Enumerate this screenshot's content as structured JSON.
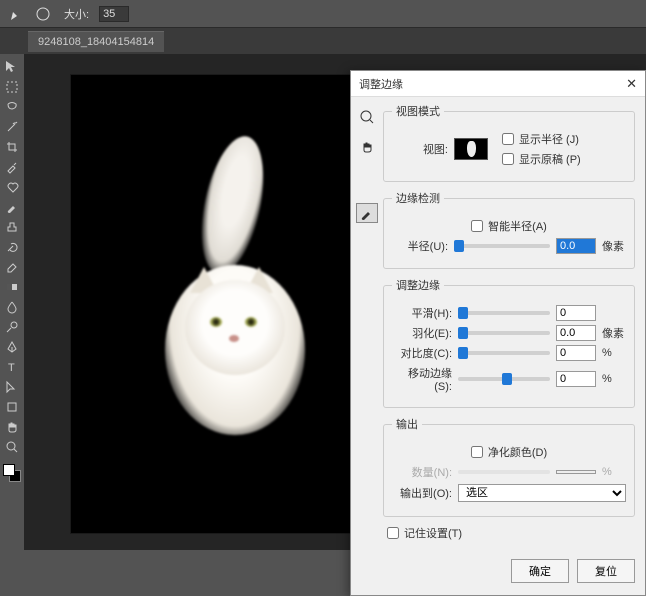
{
  "topbar": {
    "size_label": "大小:",
    "size_value": "35"
  },
  "tab": {
    "name": "9248108_18404154814"
  },
  "dialog": {
    "title": "调整边缘",
    "view": {
      "legend": "视图模式",
      "view_label": "视图:",
      "show_radius": "显示半径 (J)",
      "show_original": "显示原稿 (P)"
    },
    "edge": {
      "legend": "边缘检测",
      "smart_radius": "智能半径(A)",
      "radius_label": "半径(U):",
      "radius_value": "0.0",
      "radius_unit": "像素"
    },
    "adjust": {
      "legend": "调整边缘",
      "smooth_label": "平滑(H):",
      "smooth_value": "0",
      "feather_label": "羽化(E):",
      "feather_value": "0.0",
      "feather_unit": "像素",
      "contrast_label": "对比度(C):",
      "contrast_value": "0",
      "contrast_unit": "%",
      "shift_label": "移动边缘(S):",
      "shift_value": "0",
      "shift_unit": "%"
    },
    "output": {
      "legend": "输出",
      "decontaminate": "净化颜色(D)",
      "amount_label": "数量(N):",
      "amount_unit": "%",
      "output_to_label": "输出到(O):",
      "output_to_value": "选区"
    },
    "remember": "记住设置(T)",
    "ok": "确定",
    "reset": "复位"
  }
}
